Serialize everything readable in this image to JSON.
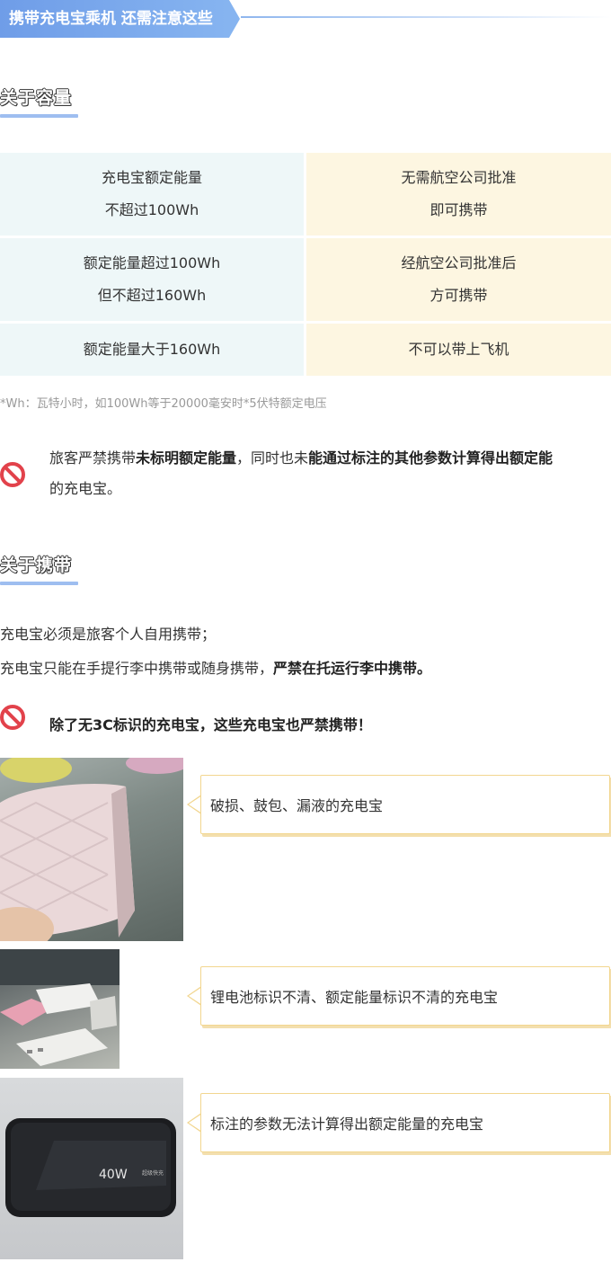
{
  "banner": {
    "title": "携带充电宝乘机 还需注意这些"
  },
  "section_capacity": {
    "title": "关于容量"
  },
  "capacity_table": {
    "rows": [
      {
        "condition": [
          "充电宝额定能量",
          "不超过100Wh"
        ],
        "rule": [
          "无需航空公司批准",
          "即可携带"
        ]
      },
      {
        "condition": [
          "额定能量超过100Wh",
          "但不超过160Wh"
        ],
        "rule": [
          "经航空公司批准后",
          "方可携带"
        ]
      },
      {
        "condition": [
          "额定能量大于160Wh"
        ],
        "rule": [
          "不可以带上飞机"
        ]
      }
    ]
  },
  "footnote": "*Wh：瓦特小时，如100Wh等于20000毫安时*5伏特额定电压",
  "notice_unmarked": {
    "part1": "旅客严禁携带",
    "bold1": "未标明额定能量",
    "part2": "，同时也未",
    "bold2": "能通过标注的其他参数计算得出额定能",
    "line2": "的充电宝。",
    "icon": "prohibit-icon"
  },
  "section_carry": {
    "title": "关于携带"
  },
  "carry_rules": {
    "line1": "充电宝必须是旅客个人自用携带；",
    "line2_part": "充电宝只能在手提行李中携带或随身携带，",
    "line2_bold": "严禁在托运行李中携带。"
  },
  "notice_3c": {
    "text": "除了无3C标识的充电宝，这些充电宝也严禁携带！",
    "icon": "prohibit-icon"
  },
  "examples": [
    {
      "caption": "破损、鼓包、漏液的充电宝"
    },
    {
      "caption": "锂电池标识不清、额定能量标识不清的充电宝"
    },
    {
      "caption": "标注的参数无法计算得出额定能量的充电宝",
      "device_label": "40W",
      "device_brand": "超级快充"
    }
  ],
  "colors": {
    "banner": "#7aa7ec",
    "table_left": "#eef7f8",
    "table_right": "#fdf6e1",
    "prohibit": "#e2424b",
    "callout_border": "#f2d68f"
  }
}
